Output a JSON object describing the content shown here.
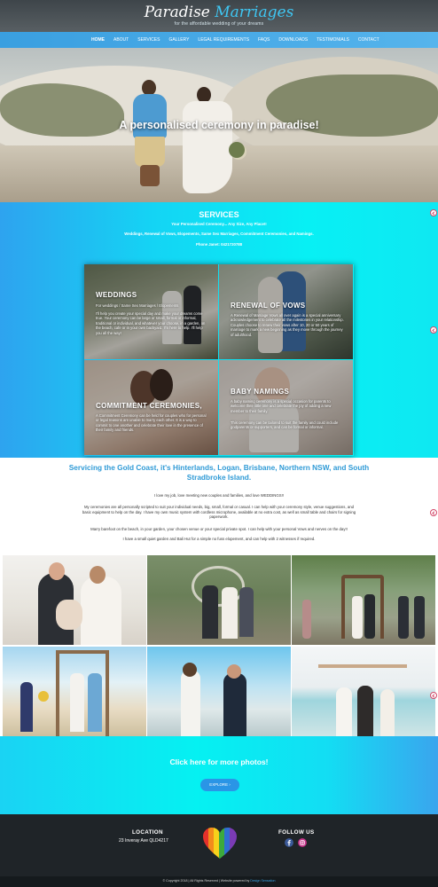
{
  "header": {
    "logo_word1": "Paradise",
    "logo_word2": "Marriages",
    "tagline": "for the affordable wedding of your dreams"
  },
  "nav": {
    "items": [
      {
        "label": "HOME"
      },
      {
        "label": "ABOUT"
      },
      {
        "label": "SERVICES"
      },
      {
        "label": "GALLERY"
      },
      {
        "label": "LEGAL REQUIREMENTS"
      },
      {
        "label": "FAQS"
      },
      {
        "label": "DOWNLOADS"
      },
      {
        "label": "TESTIMONIALS"
      },
      {
        "label": "CONTACT"
      }
    ],
    "active": "HOME"
  },
  "hero": {
    "title": "A personalised ceremony in paradise!"
  },
  "services": {
    "title": "SERVICES",
    "line1": "Your Personalised Ceremony... Any Size, Any Place!!",
    "line2": "Weddings, Renewal of Vows, Elopements, Same Sex Marriages, Commitment Ceremonies, and Namings.",
    "line3": "Phone Janet: 0421720788",
    "tiles": [
      {
        "title": "WEDDINGS",
        "text1": "For weddings / Same Sex Marriages / Elopements",
        "text2": "I'll help you create your special day and make your dreams come true. Your ceremony can be large or small, formal or informal, traditional or individual, and whatever your choose, in a garden, on the beach, cafe or in your own backyard. I'm here to help. I'll help you all the way!"
      },
      {
        "title": "RENEWAL OF VOWS",
        "text1": "A Renewal of Marriage Vows all over again is a special anniversary acknowledgement to celebrate all the milestones in your relationship. Couples choose to renew their vows after 10, 20 or 50 years of marriage to mark a new beginning as they move through the journey of adulthood."
      },
      {
        "title": "COMMITMENT CEREMONIES,",
        "text1": "A Commitment Ceremony can be held for couples who for personal or legal reasons are unable to marry each other. It is a way to commit to one another and celebrate their love in the presence of their family and friends."
      },
      {
        "title": "BABY NAMINGS",
        "text1": "A baby naming ceremony is a special occasion for parents to welcome their little one and celebrate the joy of adding a new member to their family.",
        "text2": "This ceremony can be tailored to suit the family and could include godparents or supporters, and can be formal or informal."
      }
    ]
  },
  "intro": {
    "heading": "Servicing the Gold Coast, it's Hinterlands, Logan, Brisbane, Northern NSW, and South Stradbroke Island.",
    "p1": "I love my job, love meeting new couples and families, and love WEDDINGS!!",
    "p2": "My ceremonies are all personally scripted to suit your individual needs, big, small, formal or casual. I can help with your ceremony style, venue suggestions, and basic equipment to help on the day. I have my own music system with cordless microphone, available at no extra cost, as well as small table and chairs for signing paperwork.",
    "p3": "Marry barefoot on the beach, in your garden, your chosen venue or your special private spot. I can help with your personal Vows and nerves on the day!!",
    "p4": "I have a small quiet garden and Bali Hut for a simple no fuss elopement, and can help with 2 witnesses if required."
  },
  "cta": {
    "title": "Click here for more photos!",
    "button": "EXPLORE ›"
  },
  "footer": {
    "location_head": "LOCATION",
    "address": "23 Inveray Ave QLD4217",
    "follow_head": "FOLLOW US",
    "copyright": "© Copyright 2018 | All Rights Reserved | Website powered by",
    "developer": "Design Sensation"
  },
  "colors": {
    "accent_blue": "#2f9ad6",
    "nav_blue": "#3a9fe0",
    "cyan": "#07f0f4",
    "footer_dark": "#1f2428"
  }
}
